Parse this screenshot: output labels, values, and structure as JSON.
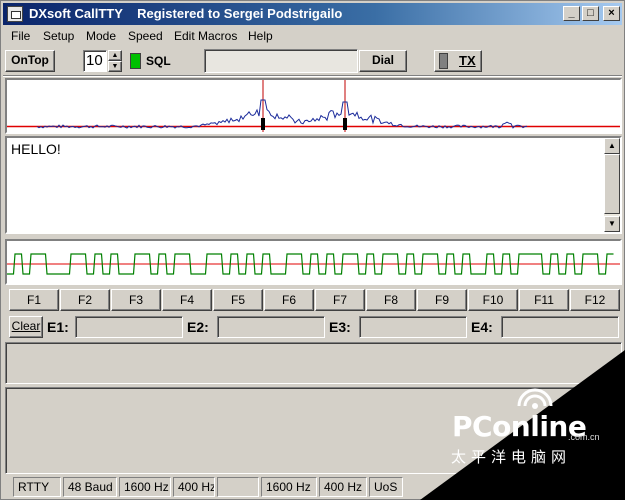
{
  "window": {
    "title": "DXsoft CallTTY    Registered to Sergei Podstrigailo",
    "minimize": "_",
    "maximize": "□",
    "close": "×"
  },
  "menu": [
    "File",
    "Setup",
    "Mode",
    "Speed",
    "Edit Macros",
    "Help"
  ],
  "toolbar": {
    "ontop_label": "OnTop",
    "squelch_value": "10",
    "spin_up": "▲",
    "spin_down": "▼",
    "sql_label": "SQL",
    "sql_indicator_color": "#00c000",
    "call_field_value": "",
    "dial_label": "Dial",
    "tx_label": "TX",
    "tx_indicator_color": "#808080"
  },
  "receive_text": "HELLO!",
  "scroll": {
    "up": "▲",
    "down": "▼"
  },
  "function_keys": [
    "F1",
    "F2",
    "F3",
    "F4",
    "F5",
    "F6",
    "F7",
    "F8",
    "F9",
    "F10",
    "F11",
    "F12"
  ],
  "entry": {
    "clear_label": "Clear",
    "labels": [
      "E1:",
      "E2:",
      "E3:",
      "E4:"
    ],
    "values": [
      "",
      "",
      "",
      ""
    ]
  },
  "status_bar": [
    "RTTY",
    "48 Baud",
    "1600 Hz",
    "400 Hz",
    "",
    "1600 Hz",
    "400 Hz",
    "UoS"
  ],
  "watermark": {
    "brand": "PConline",
    "domain": ".com.cn",
    "chinese": "太平洋电脑网"
  },
  "colors": {
    "spectrum_trace": "#1a2a9a",
    "threshold_line": "#e00000",
    "marker_line": "#c00000",
    "baseband_trace": "#008000"
  }
}
